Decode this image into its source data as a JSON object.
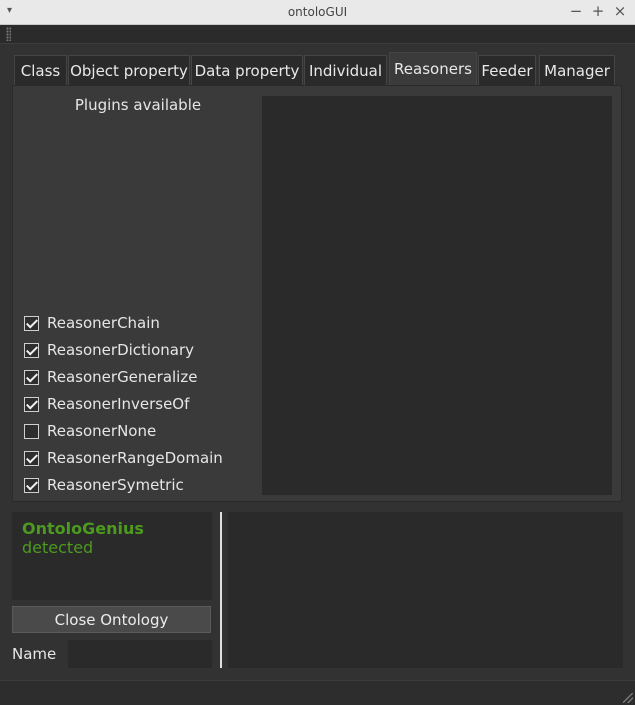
{
  "window": {
    "title": "ontoloGUI",
    "menu_icon": "▾",
    "minimize_icon": "−",
    "maximize_icon": "+",
    "close_icon": "×"
  },
  "tabs": [
    {
      "label": "Class"
    },
    {
      "label": "Object property"
    },
    {
      "label": "Data property"
    },
    {
      "label": "Individual"
    },
    {
      "label": "Reasoners",
      "active": true
    },
    {
      "label": "Feeder"
    },
    {
      "label": "Manager"
    }
  ],
  "reasoners": {
    "plugins_label": "Plugins available",
    "items": [
      {
        "label": "ReasonerChain",
        "checked": true
      },
      {
        "label": "ReasonerDictionary",
        "checked": true
      },
      {
        "label": "ReasonerGeneralize",
        "checked": true
      },
      {
        "label": "ReasonerInverseOf",
        "checked": true
      },
      {
        "label": "ReasonerNone",
        "checked": false
      },
      {
        "label": "ReasonerRangeDomain",
        "checked": true
      },
      {
        "label": "ReasonerSymetric",
        "checked": true
      }
    ]
  },
  "status": {
    "brand": "OntoloGenius",
    "text": "detected",
    "color": "#4c9a1f"
  },
  "controls": {
    "close_button": "Close Ontology",
    "name_label": "Name",
    "name_value": ""
  }
}
